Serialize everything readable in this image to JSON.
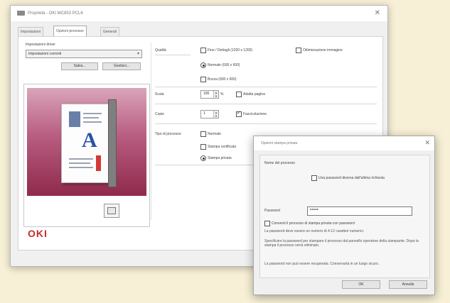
{
  "window": {
    "title": "Proprietà - OKI MC853 PCL6",
    "tabs": [
      "Impostazioni",
      "Opzioni processo",
      "Generali"
    ],
    "active_tab_index": 1
  },
  "driver_settings": {
    "group_label": "Impostazioni driver",
    "selected_value": "Impostazioni correnti",
    "save_button": "Salva...",
    "manage_button": "Gestisci..."
  },
  "options": {
    "quality_label": "Qualità",
    "quality_options": [
      {
        "label": "Fine / Dettagli (1200 x 1200)",
        "checked": false
      },
      {
        "label": "Normale (600 x 600)",
        "checked": true
      },
      {
        "label": "Bozza (600 x 600)",
        "checked": false
      }
    ],
    "image_enhancement_label": "Ottimizzazione immagine",
    "image_enhancement_checked": false,
    "scale_label": "Scala",
    "scale_value": "100",
    "scale_unit": "%",
    "fit_label": "Adatta pagina",
    "fit_checked": false,
    "copies_label": "Copie",
    "copies_value": "1",
    "collate_label": "Fascicolazione",
    "collate_checked": true,
    "job_type_label": "Tipo di processo",
    "job_types": [
      {
        "label": "Normale",
        "checked": false
      },
      {
        "label": "Stampa certificata",
        "checked": false
      },
      {
        "label": "Stampa privata",
        "checked": true
      }
    ]
  },
  "preview": {
    "brand": "OKI"
  },
  "sub_dialog": {
    "title": "Opzioni stampa privata",
    "section_label": "Nome del processo",
    "request_name_label": "Una password diversa dall'ultima richiesta",
    "request_name_checked": false,
    "password_label": "Password",
    "password_value": "*****",
    "enable_label": "Consenti il processo di stampa privata con password",
    "enable_checked": false,
    "description_1": "La password deve essere un numero di 4-12 caratteri numerici.",
    "description_2": "Specificare la password per stampare il processo dal pannello operatore della stampante. Dopo la stampa il processo verrà eliminato.",
    "description_3": "La password non può essere recuperata. Conservarla in un luogo sicuro.",
    "ok_button": "OK",
    "cancel_button": "Annulla"
  }
}
